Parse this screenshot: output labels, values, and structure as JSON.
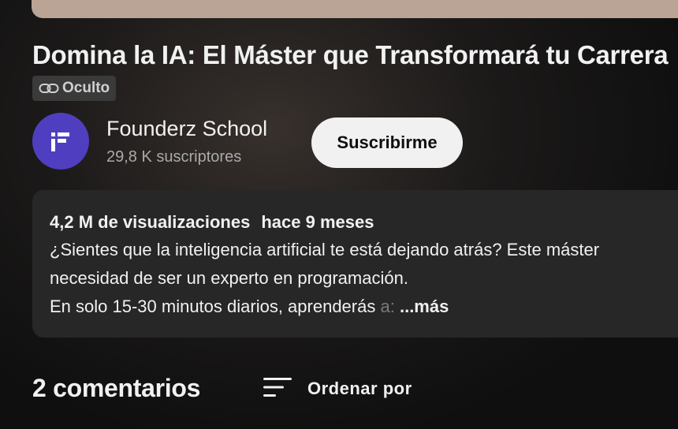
{
  "video": {
    "title": "Domina la IA: El Máster que Transformará tu Carrera",
    "visibility": "Oculto"
  },
  "channel": {
    "name": "Founderz School",
    "subscribers": "29,8 K suscriptores",
    "avatar_color": "#4f3fc0",
    "subscribe_label": "Suscribirme"
  },
  "description": {
    "views": "4,2 M de visualizaciones",
    "age": "hace 9 meses",
    "line1": "¿Sientes que la inteligencia artificial te está dejando atrás? Este máster",
    "line2": "necesidad de ser un experto en programación.",
    "line3": "En solo 15-30 minutos diarios, aprenderás",
    "line3_faded": "a:",
    "more_label": "...más"
  },
  "comments": {
    "count_label": "2 comentarios",
    "sort_label": "Ordenar por",
    "sort_icon": "sort-icon"
  }
}
